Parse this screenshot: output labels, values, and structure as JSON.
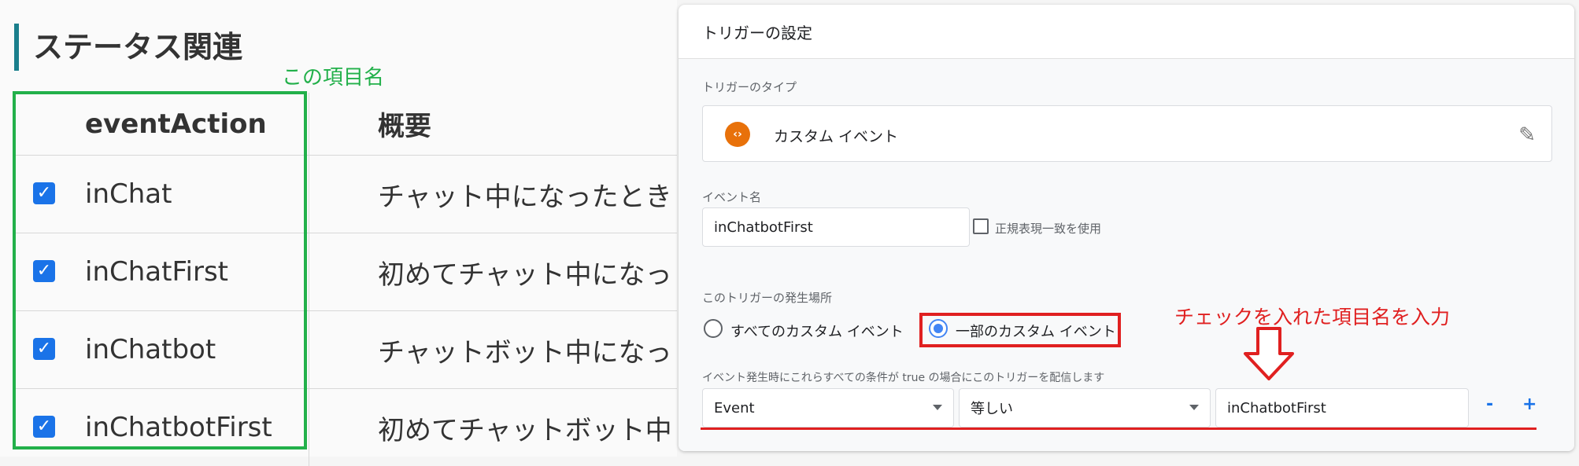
{
  "left": {
    "section_title": "ステータス関連",
    "annotation": "この項目名",
    "headers": {
      "event_action": "eventAction",
      "summary": "概要"
    },
    "rows": [
      {
        "checked": true,
        "event_action": "inChat",
        "summary": "チャット中になったとき"
      },
      {
        "checked": true,
        "event_action": "inChatFirst",
        "summary": "初めてチャット中になっ"
      },
      {
        "checked": true,
        "event_action": "inChatbot",
        "summary": "チャットボット中になっ"
      },
      {
        "checked": true,
        "event_action": "inChatbotFirst",
        "summary": "初めてチャットボット中"
      }
    ],
    "colors": {
      "annotation_box": "#22b04a",
      "checkbox": "#1a73e8",
      "title_bar": "#1a7f8c"
    }
  },
  "trigger": {
    "title": "トリガーの設定",
    "type_label": "トリガーのタイプ",
    "type_icon": "code-brackets-icon",
    "type_name": "カスタム イベント",
    "event_name_label": "イベント名",
    "event_name_value": "inChatbotFirst",
    "regex_label": "正規表現一致を使用",
    "fire_label": "このトリガーの発生場所",
    "radio_all": "すべてのカスタム イベント",
    "radio_some": "一部のカスタム イベント",
    "radio_selected": "some",
    "condition_label": "イベント発生時にこれらすべての条件が true の場合にこのトリガーを配信します",
    "condition": {
      "variable": "Event",
      "operator": "等しい",
      "value": "inChatbotFirst"
    },
    "minus": "-",
    "plus": "+",
    "annotation": "チェックを入れた項目名を入力",
    "colors": {
      "accent": "#e8710a",
      "annotation": "#e02020",
      "radio": "#4285f4"
    }
  }
}
